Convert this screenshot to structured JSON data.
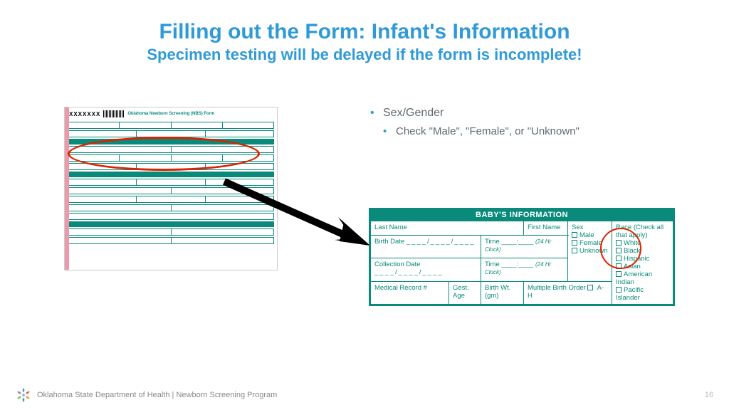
{
  "title": {
    "main": "Filling out the Form: Infant's Information",
    "sub": "Specimen testing will be delayed if the form is incomplete!"
  },
  "bullets": {
    "level1": "Sex/Gender",
    "level2": "Check \"Male\", \"Female\", or \"Unknown\""
  },
  "form_thumb": {
    "serial": "XXXXXXX",
    "title": "Oklahoma Newborn Screening (NBS) Form"
  },
  "detail": {
    "header": "BABY'S INFORMATION",
    "labels": {
      "last_name": "Last Name",
      "first_name": "First Name",
      "birth_date": "Birth Date",
      "time": "Time",
      "clock_hint": "(24 Hr Clock)",
      "collection_date": "Collection Date",
      "medical_record": "Medical Record #",
      "gest_age": "Gest. Age",
      "birth_wt": "Birth Wt. (gm)",
      "multiple_birth": "Multiple Birth Order",
      "multiple_range": "A-H",
      "sex": "Sex",
      "race": "Race (Check all that apply)",
      "slash3": "____/____/____",
      "time_blank": "____:____"
    },
    "sex_options": [
      "Male",
      "Female",
      "Unknown"
    ],
    "race_options": [
      "White",
      "Black",
      "Hispanic",
      "Asian",
      "American Indian",
      "Pacific Islander"
    ]
  },
  "footer": {
    "org": "Oklahoma State Department of Health | Newborn Screening Program",
    "page": "16"
  },
  "colors": {
    "accent": "#2f9ad6",
    "form": "#0a8a7a",
    "highlight": "#d20"
  }
}
